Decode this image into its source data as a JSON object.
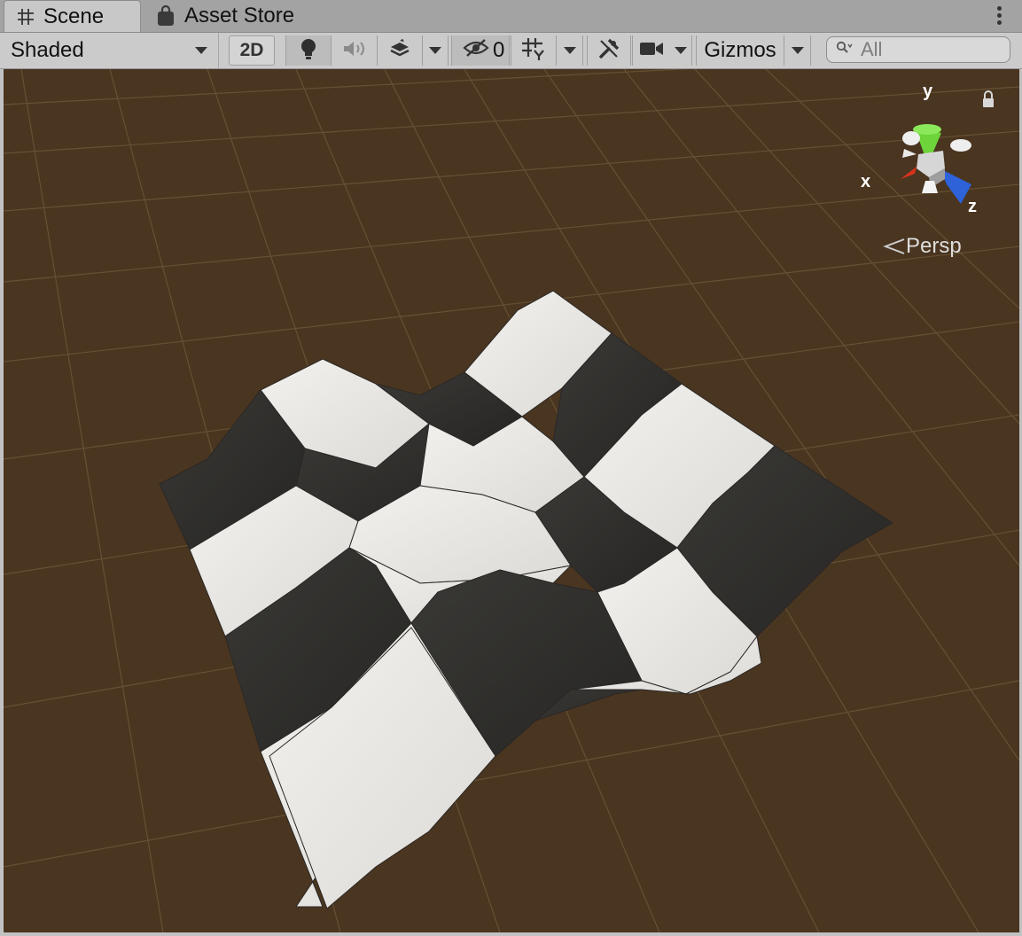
{
  "tabs": {
    "scene_label": "Scene",
    "asset_store_label": "Asset Store"
  },
  "toolbar": {
    "draw_mode": "Shaded",
    "mode_2d_label": "2D",
    "hidden_count": "0",
    "gizmos_label": "Gizmos",
    "search_placeholder": "All"
  },
  "viewport": {
    "projection_label": "Persp",
    "gizmo_axes": {
      "x": "x",
      "y": "y",
      "z": "z"
    },
    "background_color": "#4a3520",
    "grid_color": "#6b5a3f"
  },
  "icons": {
    "scene_tab": "grid-hash-icon",
    "asset_store_tab": "shopping-bag-icon",
    "lighting": "lightbulb-icon",
    "audio": "speaker-icon",
    "effects": "layers-effects-icon",
    "visibility": "eye-slash-icon",
    "grid": "grid-snap-icon",
    "tools": "wrench-tools-icon",
    "camera": "video-camera-icon",
    "search": "search-icon",
    "lock": "padlock-icon"
  }
}
